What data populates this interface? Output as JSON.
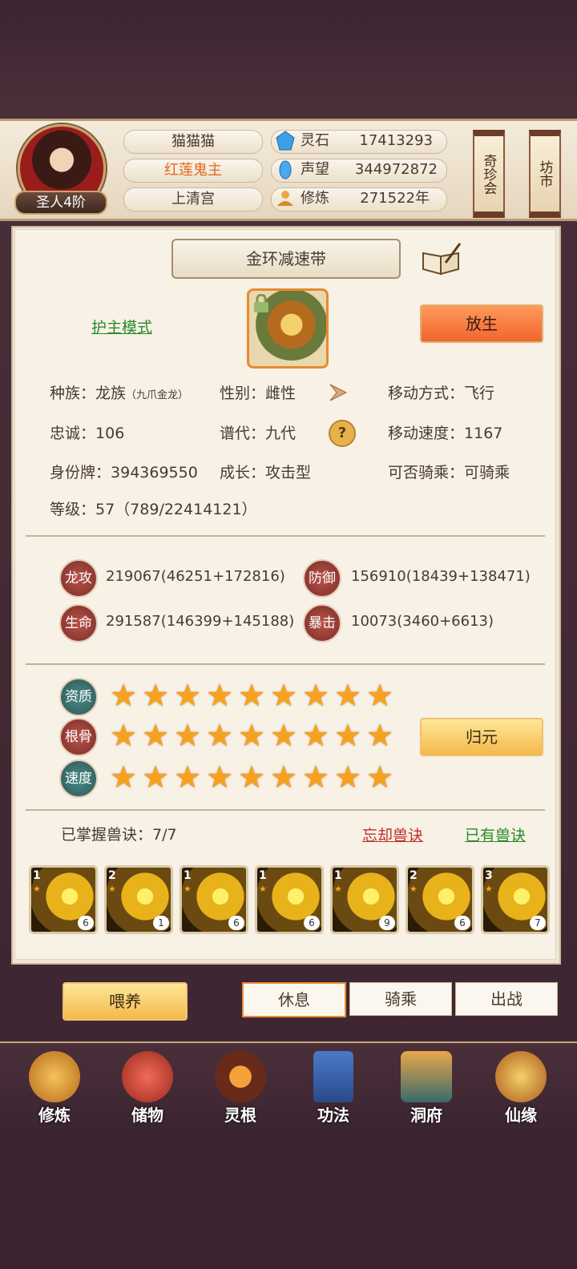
{
  "header": {
    "player_name": "猫猫猫",
    "title": "红莲鬼主",
    "sect": "上清宫",
    "rank": "圣人4阶",
    "resources": [
      {
        "icon": "spirit-stone-icon",
        "label": "灵石",
        "value": "17413293"
      },
      {
        "icon": "reputation-icon",
        "label": "声望",
        "value": "344972872"
      },
      {
        "icon": "cultivation-icon",
        "label": "修炼",
        "value": "271522年"
      }
    ],
    "shortcuts": [
      "奇珍会",
      "坊市"
    ]
  },
  "pet": {
    "equipment_name": "金环减速带",
    "guard_mode": "护主模式",
    "release_button": "放生",
    "info": [
      {
        "label": "种族：",
        "value": "龙族",
        "sub": "（九爪金龙）"
      },
      {
        "label": "性别：",
        "value": "雌性"
      },
      {
        "label": "移动方式：",
        "value": "飞行"
      },
      {
        "label": "忠诚：",
        "value": "106"
      },
      {
        "label": "谱代：",
        "value": "九代"
      },
      {
        "label": "移动速度：",
        "value": "1167"
      },
      {
        "label": "身份牌：",
        "value": "394369550"
      },
      {
        "label": "成长：",
        "value": "攻击型"
      },
      {
        "label": "可否骑乘：",
        "value": "可骑乘"
      }
    ],
    "level_text": "等级：57（789/22414121）"
  },
  "stats": [
    {
      "label": "龙攻",
      "value": "219067(46251+172816)"
    },
    {
      "label": "防御",
      "value": "156910(18439+138471)"
    },
    {
      "label": "生命",
      "value": "291587(146399+145188)"
    },
    {
      "label": "暴击",
      "value": "10073(3460+6613)"
    }
  ],
  "qualities": [
    {
      "label": "资质",
      "stars": 9
    },
    {
      "label": "根骨",
      "stars": 9
    },
    {
      "label": "速度",
      "stars": 9
    }
  ],
  "return_button": "归元",
  "skills": {
    "mastered_text": "已掌握兽诀：7/7",
    "forget_link": "忘却兽诀",
    "owned_link": "已有兽诀",
    "items": [
      {
        "level": "1",
        "count": "6"
      },
      {
        "level": "2",
        "count": "1"
      },
      {
        "level": "1",
        "count": "6"
      },
      {
        "level": "1",
        "count": "6"
      },
      {
        "level": "1",
        "count": "9"
      },
      {
        "level": "2",
        "count": "6"
      },
      {
        "level": "3",
        "count": "7"
      }
    ]
  },
  "actions": {
    "feed": "喂养",
    "tabs": [
      "休息",
      "骑乘",
      "出战"
    ]
  },
  "nav": [
    "修炼",
    "储物",
    "灵根",
    "功法",
    "洞府",
    "仙缘"
  ],
  "colors": {
    "accent_orange": "#f0652e",
    "link_green": "#2a8a2a",
    "link_red": "#c0302a",
    "title_orange": "#e06a1a"
  }
}
